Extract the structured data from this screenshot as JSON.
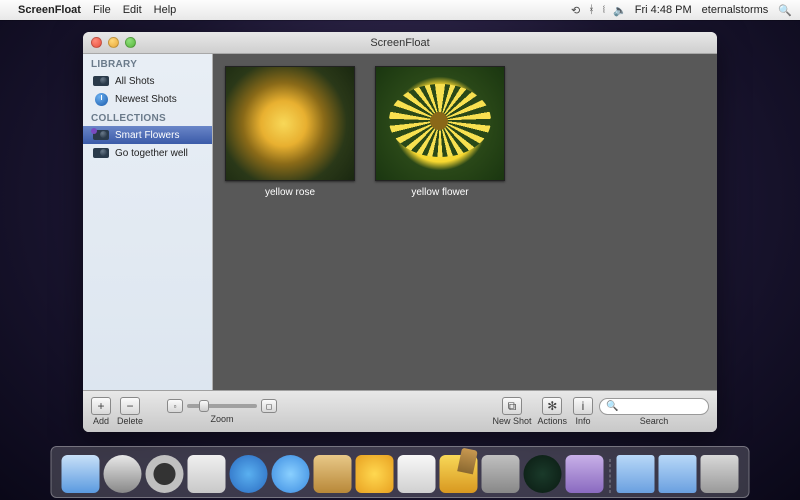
{
  "menubar": {
    "app": "ScreenFloat",
    "items": [
      "File",
      "Edit",
      "Help"
    ],
    "time": "Fri 4:48 PM",
    "user": "eternalstorms"
  },
  "window": {
    "title": "ScreenFloat"
  },
  "sidebar": {
    "library_heading": "LIBRARY",
    "collections_heading": "COLLECTIONS",
    "library": [
      {
        "label": "All Shots"
      },
      {
        "label": "Newest Shots"
      }
    ],
    "collections": [
      {
        "label": "Smart Flowers"
      },
      {
        "label": "Go together well"
      }
    ]
  },
  "thumbs": [
    {
      "label": "yellow rose"
    },
    {
      "label": "yellow flower"
    }
  ],
  "toolbar": {
    "add": "Add",
    "delete": "Delete",
    "zoom": "Zoom",
    "newshot": "New Shot",
    "actions": "Actions",
    "info": "Info",
    "search": "Search"
  }
}
